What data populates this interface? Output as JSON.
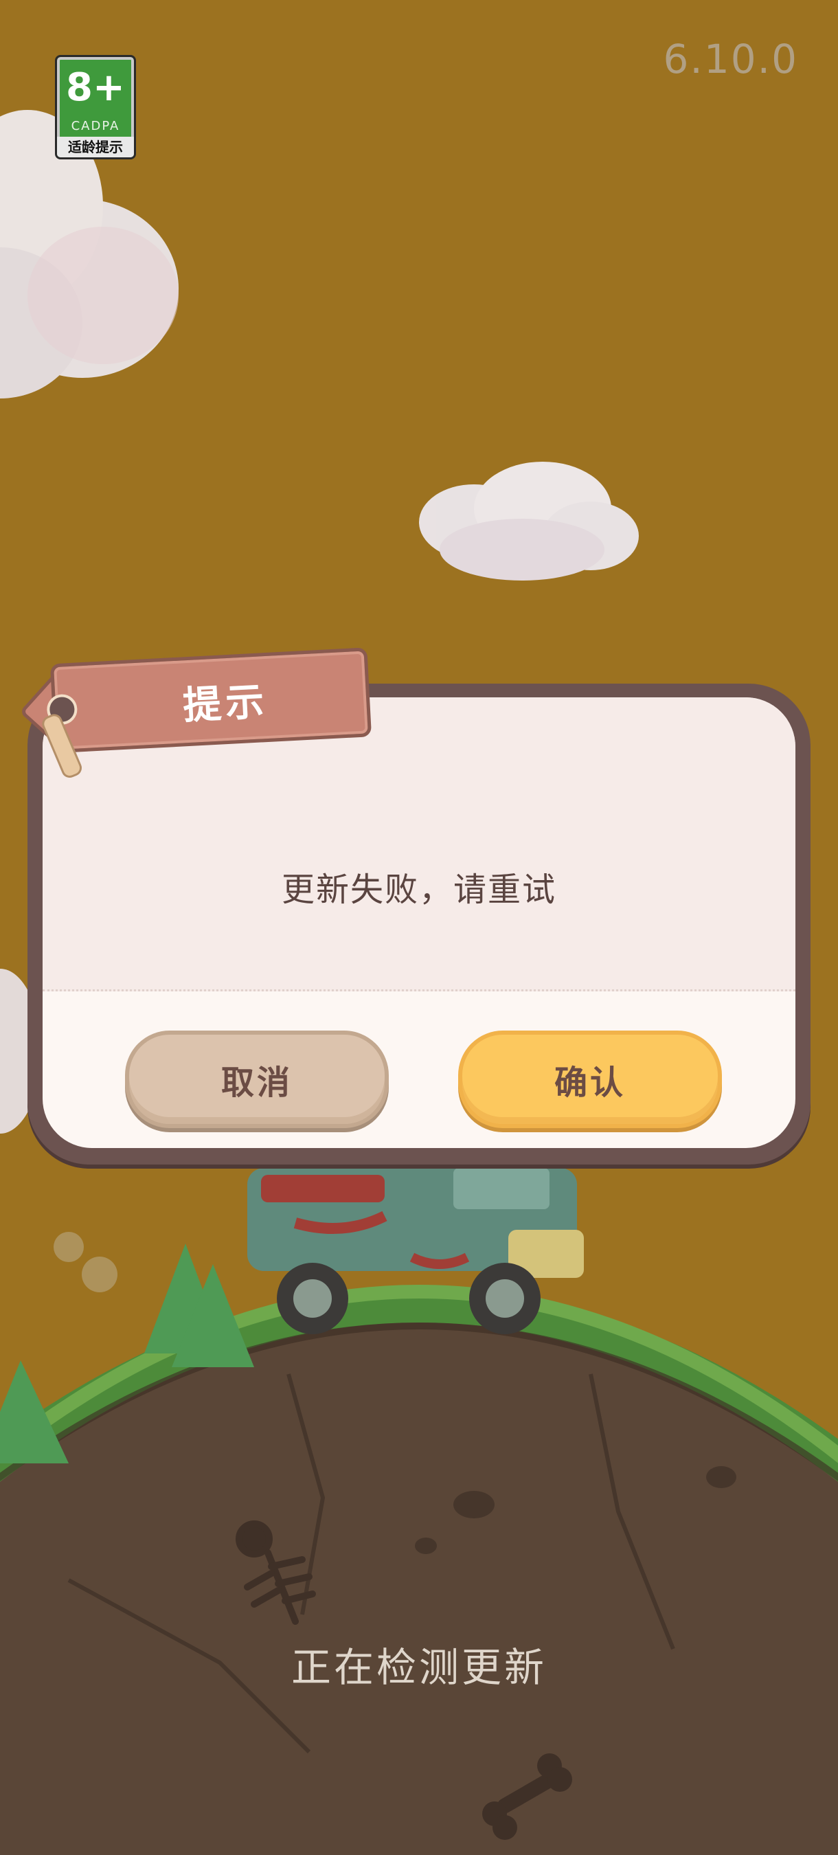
{
  "age_rating": {
    "age": "8+",
    "org": "CADPA",
    "tip": "适龄提示"
  },
  "version": "6.10.0",
  "dialog": {
    "title": "提示",
    "message": "更新失败，请重试",
    "cancel_label": "取消",
    "confirm_label": "确认"
  },
  "loading": {
    "status_text": "正在检测更新"
  },
  "colors": {
    "background": "#9c7220",
    "confirm_button": "#fcc85e",
    "cancel_button": "#dcc3ad",
    "title_tag": "#c98474"
  }
}
